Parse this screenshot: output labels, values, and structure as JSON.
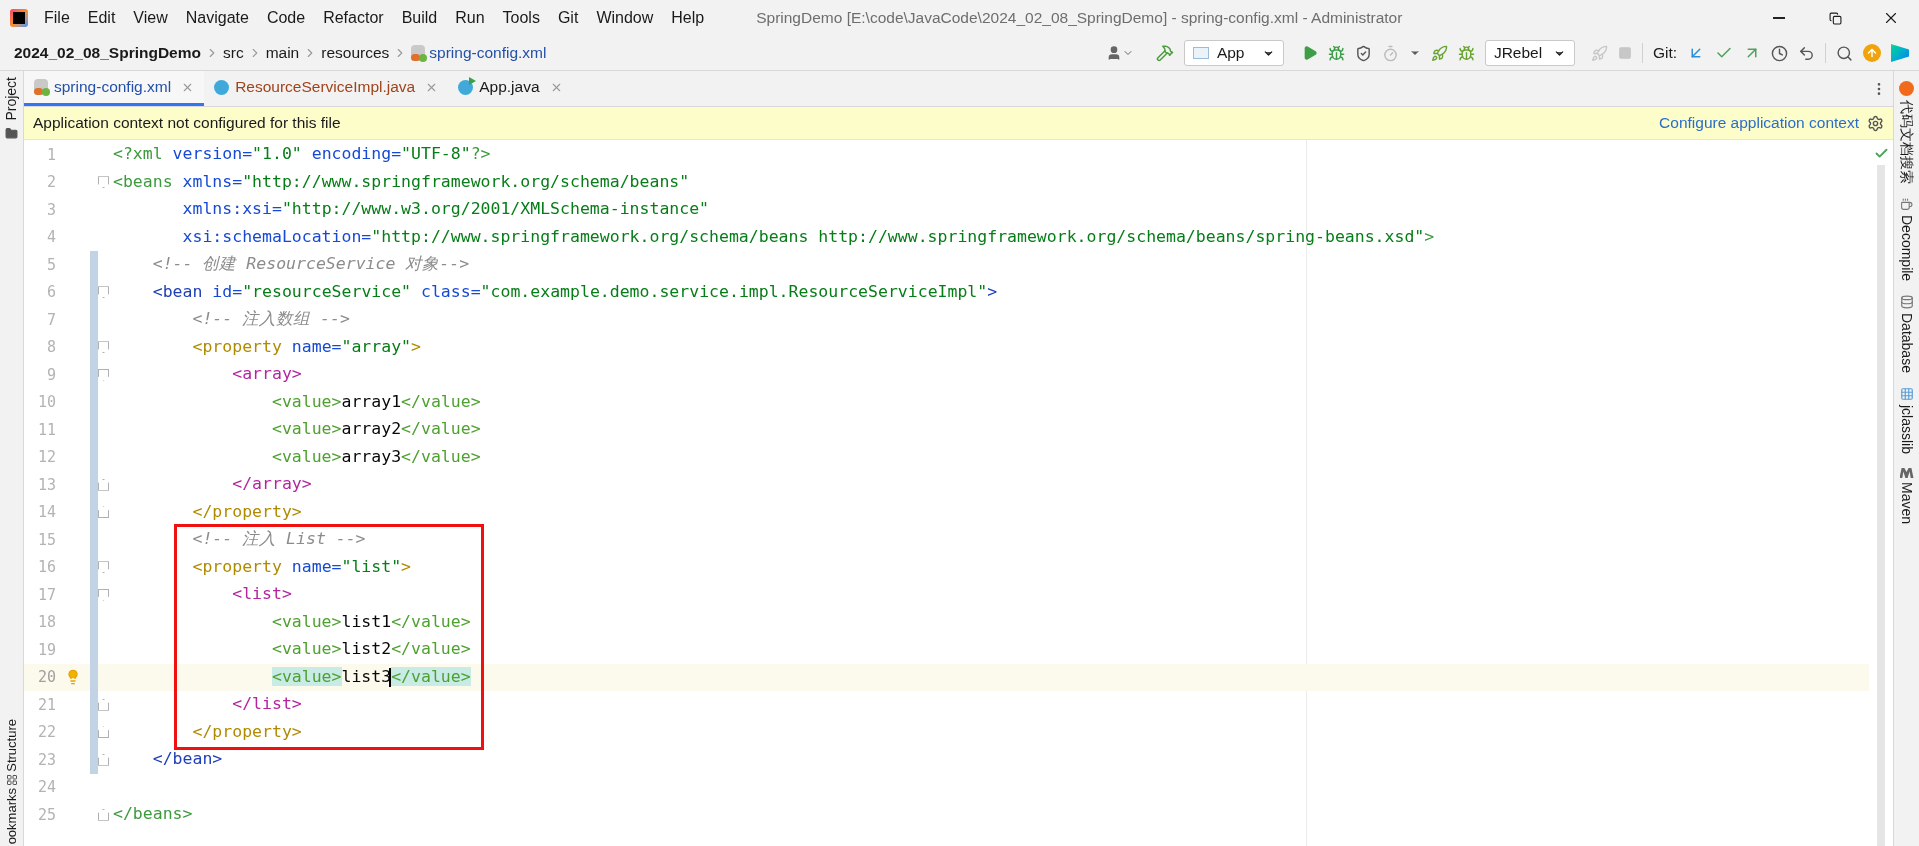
{
  "window": {
    "title": "SpringDemo [E:\\code\\JavaCode\\2024_02_08_SpringDemo] - spring-config.xml - Administrator"
  },
  "menu": [
    "File",
    "Edit",
    "View",
    "Navigate",
    "Code",
    "Refactor",
    "Build",
    "Run",
    "Tools",
    "Git",
    "Window",
    "Help"
  ],
  "breadcrumb": [
    {
      "text": "2024_02_08_SpringDemo",
      "kind": "project"
    },
    {
      "text": "src",
      "kind": "folder"
    },
    {
      "text": "main",
      "kind": "folder"
    },
    {
      "text": "resources",
      "kind": "folder"
    },
    {
      "text": "spring-config.xml",
      "kind": "file"
    }
  ],
  "toolbar": {
    "run_config": "App",
    "jrebel": "JRebel",
    "git_label": "Git:"
  },
  "tabs": [
    {
      "label": "spring-config.xml",
      "kind": "xml",
      "selected": true,
      "color": "#2350a8"
    },
    {
      "label": "ResourceServiceImpl.java",
      "kind": "class",
      "selected": false,
      "color": "#a0431b"
    },
    {
      "label": "App.java",
      "kind": "app",
      "selected": false,
      "color": "#1a1a1a"
    }
  ],
  "banner": {
    "text": "Application context not configured for this file",
    "link": "Configure application context"
  },
  "left_tools": {
    "top": [
      "Project"
    ],
    "bottom": [
      "Structure",
      "ookmarks"
    ]
  },
  "right_tools": [
    {
      "label": "代码文档搜索",
      "kind": "search"
    },
    {
      "label": "Decompile",
      "kind": "decompile"
    },
    {
      "label": "Database",
      "kind": "database"
    },
    {
      "label": "jclasslib",
      "kind": "jclasslib"
    },
    {
      "label": "Maven",
      "kind": "maven"
    }
  ],
  "editor": {
    "sections": [
      {
        "boxed": false,
        "lines": [
          {
            "number": "1",
            "changed": false,
            "current": false,
            "tokens": [
              {
                "kind": "tag",
                "text": "<?xml",
                "color": "#3c9b3c"
              },
              {
                "kind": "attr",
                "text": " version="
              },
              {
                "kind": "string",
                "text": "\"1.0\""
              },
              {
                "kind": "attr",
                "text": " encoding="
              },
              {
                "kind": "string",
                "text": "\"UTF-8\""
              },
              {
                "kind": "tag",
                "text": "?>",
                "color": "#3c9b3c"
              }
            ]
          },
          {
            "number": "2",
            "fold_open": true,
            "changed": false,
            "current": false,
            "tokens": [
              {
                "kind": "tag",
                "text": "<beans",
                "color": "#3c9b3c"
              },
              {
                "kind": "attr",
                "text": " xmlns="
              },
              {
                "kind": "string",
                "text": "\"http://www.springframework.org/schema/beans\""
              }
            ]
          },
          {
            "number": "3",
            "changed": false,
            "current": false,
            "tokens": [
              {
                "kind": "attr",
                "text": "       xmlns:xsi="
              },
              {
                "kind": "string",
                "text": "\"http://www.w3.org/2001/XMLSchema-instance\""
              }
            ]
          },
          {
            "number": "4",
            "changed": false,
            "current": false,
            "tokens": [
              {
                "kind": "attr",
                "text": "       xsi:schemaLocation="
              },
              {
                "kind": "string",
                "text": "\"http://www.springframework.org/schema/beans http://www.springframework.org/schema/beans/spring-beans.xsd\""
              },
              {
                "kind": "tag",
                "text": ">",
                "color": "#3c9b3c"
              }
            ]
          },
          {
            "number": "5",
            "changed": true,
            "current": false,
            "tokens": [
              {
                "kind": "comment",
                "text": "    <!-- 创建 ResourceService 对象-->"
              }
            ]
          },
          {
            "number": "6",
            "fold_open": true,
            "changed": true,
            "current": false,
            "tokens": [
              {
                "kind": "tag",
                "text": "    <bean",
                "color": "#1f3fb8"
              },
              {
                "kind": "attr",
                "text": " id="
              },
              {
                "kind": "string",
                "text": "\"resourceService\""
              },
              {
                "kind": "attr",
                "text": " class="
              },
              {
                "kind": "string",
                "text": "\"com.example.demo.service.impl.ResourceServiceImpl\""
              },
              {
                "kind": "tag",
                "text": ">",
                "color": "#1f3fb8"
              }
            ]
          },
          {
            "number": "7",
            "changed": true,
            "current": false,
            "tokens": [
              {
                "kind": "comment",
                "text": "        <!-- 注入数组 -->"
              }
            ]
          },
          {
            "number": "8",
            "fold_open": true,
            "changed": true,
            "current": false,
            "tokens": [
              {
                "kind": "tag",
                "text": "        <property",
                "color": "#b08a00"
              },
              {
                "kind": "attr",
                "text": " name="
              },
              {
                "kind": "string",
                "text": "\"array\""
              },
              {
                "kind": "tag",
                "text": ">",
                "color": "#b08a00"
              }
            ]
          },
          {
            "number": "9",
            "fold_open": true,
            "changed": true,
            "current": false,
            "tokens": [
              {
                "kind": "tag",
                "text": "            <array>",
                "color": "#b3259e"
              }
            ]
          },
          {
            "number": "10",
            "changed": true,
            "current": false,
            "tokens": [
              {
                "kind": "tag",
                "text": "                <value>",
                "color": "#4ea12f"
              },
              {
                "kind": "text",
                "text": "array1"
              },
              {
                "kind": "tag",
                "text": "</value>",
                "color": "#4ea12f"
              }
            ]
          },
          {
            "number": "11",
            "changed": true,
            "current": false,
            "tokens": [
              {
                "kind": "tag",
                "text": "                <value>",
                "color": "#4ea12f"
              },
              {
                "kind": "text",
                "text": "array2"
              },
              {
                "kind": "tag",
                "text": "</value>",
                "color": "#4ea12f"
              }
            ]
          },
          {
            "number": "12",
            "changed": true,
            "current": false,
            "tokens": [
              {
                "kind": "tag",
                "text": "                <value>",
                "color": "#4ea12f"
              },
              {
                "kind": "text",
                "text": "array3"
              },
              {
                "kind": "tag",
                "text": "</value>",
                "color": "#4ea12f"
              }
            ]
          },
          {
            "number": "13",
            "fold_close": true,
            "changed": true,
            "current": false,
            "tokens": [
              {
                "kind": "tag",
                "text": "            </array>",
                "color": "#b3259e"
              }
            ]
          },
          {
            "number": "14",
            "fold_close": true,
            "changed": true,
            "current": false,
            "tokens": [
              {
                "kind": "tag",
                "text": "        </property>",
                "color": "#b08a00"
              }
            ]
          }
        ]
      },
      {
        "boxed": true,
        "lines": [
          {
            "number": "15",
            "changed": true,
            "current": false,
            "tokens": [
              {
                "kind": "comment",
                "text": "        <!-- 注入 List -->"
              }
            ]
          },
          {
            "number": "16",
            "fold_open": true,
            "changed": true,
            "current": false,
            "tokens": [
              {
                "kind": "tag",
                "text": "        <property",
                "color": "#b08a00"
              },
              {
                "kind": "attr",
                "text": " name="
              },
              {
                "kind": "string",
                "text": "\"list\""
              },
              {
                "kind": "tag",
                "text": ">",
                "color": "#b08a00"
              }
            ]
          },
          {
            "number": "17",
            "fold_open": true,
            "changed": true,
            "current": false,
            "tokens": [
              {
                "kind": "tag",
                "text": "            <list>",
                "color": "#b3259e"
              }
            ]
          },
          {
            "number": "18",
            "changed": true,
            "current": false,
            "tokens": [
              {
                "kind": "tag",
                "text": "                <value>",
                "color": "#4ea12f"
              },
              {
                "kind": "text",
                "text": "list1"
              },
              {
                "kind": "tag",
                "text": "</value>",
                "color": "#4ea12f"
              }
            ]
          },
          {
            "number": "19",
            "changed": true,
            "current": false,
            "tokens": [
              {
                "kind": "tag",
                "text": "                <value>",
                "color": "#4ea12f"
              },
              {
                "kind": "text",
                "text": "list2"
              },
              {
                "kind": "tag",
                "text": "</value>",
                "color": "#4ea12f"
              }
            ]
          },
          {
            "number": "20",
            "changed": true,
            "current": true,
            "intention": true,
            "tokens": [
              {
                "kind": "tag",
                "text": "                <value>",
                "color": "#4ea12f",
                "matched": true
              },
              {
                "kind": "text",
                "text": "list3",
                "caret": true
              },
              {
                "kind": "tag",
                "text": "</value>",
                "color": "#4ea12f",
                "matched": true
              }
            ]
          },
          {
            "number": "21",
            "fold_close": true,
            "changed": true,
            "current": false,
            "tokens": [
              {
                "kind": "tag",
                "text": "            </list>",
                "color": "#b3259e"
              }
            ]
          },
          {
            "number": "22",
            "fold_close": true,
            "changed": true,
            "current": false,
            "tokens": [
              {
                "kind": "tag",
                "text": "        </property>",
                "color": "#b08a00"
              }
            ]
          }
        ]
      },
      {
        "boxed": false,
        "lines": [
          {
            "number": "23",
            "fold_close": true,
            "changed": true,
            "current": false,
            "tokens": [
              {
                "kind": "tag",
                "text": "    </bean>",
                "color": "#1f3fb8"
              }
            ]
          },
          {
            "number": "24",
            "changed": false,
            "current": false
          },
          {
            "number": "25",
            "fold_close": true,
            "changed": false,
            "current": false,
            "tokens": [
              {
                "kind": "tag",
                "text": "</beans>",
                "color": "#3c9b3c"
              }
            ]
          }
        ]
      }
    ]
  }
}
